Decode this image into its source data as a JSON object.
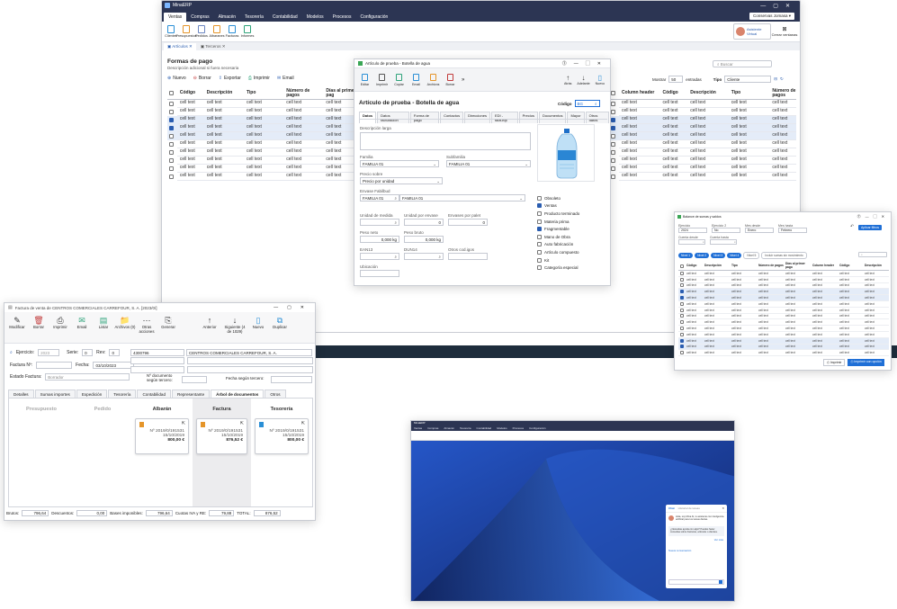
{
  "erp": {
    "title": "MinaERP",
    "menu": [
      "Ventas",
      "Compras",
      "Almacén",
      "Tesorería",
      "Contabilidad",
      "Modelos",
      "Procesos",
      "Configuración"
    ],
    "company": "Conservas Jomasa",
    "ribbon": [
      "Clientes",
      "Presupuestos",
      "Pedidos",
      "Albaranes",
      "Facturas",
      "Informes"
    ],
    "assistant": "Asistente Virtual",
    "close_windows": "Cerrar ventanas",
    "tabs": [
      "Artículos",
      "Terceros"
    ],
    "heading": "Formas de pago",
    "subheading": "Descripción adicional si fuera necesaria",
    "toolbar": [
      "Nuevo",
      "Borrar",
      "Exportar",
      "Imprimir",
      "Email"
    ],
    "columns": [
      "Código",
      "Descripción",
      "Tipo",
      "Número de pagos",
      "Días al primer pag"
    ],
    "right_columns": [
      "Column header",
      "Código",
      "Descripción",
      "Tipo",
      "Número de pagos"
    ],
    "cell": "cell text",
    "show_label": "Mostrar",
    "show_value": "50",
    "entries": "entradas",
    "type_label": "Tipo",
    "type_value": "Cliente",
    "search_placeholder": "Buscar"
  },
  "article": {
    "title": "Artículo de prueba - Botella de agua",
    "tools": [
      "Editar",
      "Imprimir",
      "Copiar",
      "Email",
      "Archivos",
      "Borrar"
    ],
    "nav": [
      "Atrás",
      "Adelante",
      "Nuevo"
    ],
    "heading": "Artículo de prueba - Botella de agua",
    "code_label": "Código",
    "code_value": "BG",
    "tabs": [
      "Datos",
      "Datos facturación",
      "Forma de pago",
      "Contactos",
      "Direcciones",
      "EDI - factur@",
      "Precios",
      "Documentos",
      "Mayor",
      "Otros datos"
    ],
    "long_desc": "Descripción larga",
    "family": "Familia",
    "family_value": "FAMILIA 01",
    "subfamily": "Subfamilia",
    "subfamily_value": "FAMILIA 01",
    "price_on": "Precio sobre",
    "price_on_value": "Precio por unidad",
    "container": "Envase Fabilbud",
    "container_value": "FAMILIA 01",
    "container_value2": "FAMILIA 01",
    "unit": "Unidad de medida",
    "unit_per": "Unidad por envase",
    "per_pallet": "Envases por palet",
    "zero": "0",
    "net_weight": "Peso neto",
    "gross_weight": "Peso bruto",
    "kg": "0,000 kg",
    "ean": "EAN13",
    "dun": "DUN14",
    "other_codes": "Otros cod.igos",
    "location": "Ubicación",
    "checks": [
      {
        "label": "Obsoleto",
        "on": false
      },
      {
        "label": "Ventas",
        "on": true
      },
      {
        "label": "Producto terminado",
        "on": false
      },
      {
        "label": "Materia prima",
        "on": false
      },
      {
        "label": "Fragmentable",
        "on": true
      },
      {
        "label": "Mano de Obra",
        "on": false
      },
      {
        "label": "Auto fabricación",
        "on": false
      },
      {
        "label": "Artículo compuesto",
        "on": false
      },
      {
        "label": "Kit",
        "on": false
      },
      {
        "label": "Categoría especial",
        "on": false
      }
    ]
  },
  "balance": {
    "title": "Balance de sumas y saldos",
    "labels": [
      "Ejercicio",
      "Ejercicio 2",
      "Mes desde",
      "Mes hasta"
    ],
    "values": [
      "2024",
      "No",
      "Enero",
      "Febrero"
    ],
    "acc_from": "Cuenta desde",
    "acc_to": "Cuenta hasta",
    "apply": "Aplicar filtros",
    "levels": [
      "Nivel 1",
      "Nivel 2",
      "Nivel 3",
      "Nivel 4",
      "Nivel 5"
    ],
    "incl": "Incluir sumas sin movimiento",
    "columns": [
      "Código",
      "Descripción",
      "Tipo",
      "Número de pagos",
      "Días al primer pago",
      "Column header",
      "Código",
      "Descripción"
    ],
    "print": "Imprimir",
    "print_excel": "Imprimir con opción"
  },
  "invoice": {
    "title": "Factura de venta de CENTROS COMERCIALES CARREFOUR, S. A. [2023/0/]",
    "tools": [
      "Modificar",
      "Borrar",
      "Imprimir",
      "Email",
      "Listar",
      "Archivos (0)",
      "Otras acciones",
      "Generar",
      "Anterior",
      "Siguiente (4 de 1029)",
      "Nuevo",
      "Duplicar"
    ],
    "ejercicio": "Ejercicio:",
    "ejercicio_v": "2023",
    "serie": "Serie:",
    "serie_v": "0",
    "rev": "Rev:",
    "rev_v": "0",
    "client_code": "4300796",
    "client_name": "CENTROS COMERCIALES CARREFOUR, S. A.",
    "factura_n": "Factura Nº:",
    "fecha": "Fecha:",
    "fecha_v": "03/10/2023",
    "estado": "Estado Factura:",
    "estado_v": "Borrador",
    "doc_tercero": "Nº documento según tercero:",
    "fecha_tercero": "Fecha según tercero:",
    "tabs": [
      "Detalles",
      "Sumas importes",
      "Expedición",
      "Tesorería",
      "Contabilidad",
      "Representante",
      "Árbol de documentos",
      "Otros"
    ],
    "columns": [
      "Presupuesto",
      "Pedido",
      "Albarán",
      "Factura",
      "Tesorería"
    ],
    "cards": [
      {
        "num": "Nº 2019/0/191531",
        "date": "15/10/2019",
        "amount": "800,00 €"
      },
      {
        "num": "Nº 2019/0/191531",
        "date": "15/10/2019",
        "amount": "876,52 €"
      },
      {
        "num": "Nº 2019/0/191531",
        "date": "15/10/2019",
        "amount": "800,00 €"
      }
    ],
    "footer": [
      {
        "l": "Brutos:",
        "v": "796,64"
      },
      {
        "l": "Descuentos:",
        "v": "0,00"
      },
      {
        "l": "Bases imponibles:",
        "v": "796,64"
      },
      {
        "l": "Cuotas IVA y RE:",
        "v": "79,88"
      },
      {
        "l": "TOTAL:",
        "v": "876,52"
      }
    ]
  },
  "desktop": {
    "chat_tabs": [
      "Chat",
      "Historial de tareas"
    ],
    "greeting": "Hola, soy Mina AI, tu asistente con inteligencia artificial para tus tareas diarias.",
    "answer": "¿Necesitas ayuda con algo? Puedes hacer consultas sobre Facturas, artículos o clientes.",
    "link": "Ver más",
    "new_chat": "Nueva conversación"
  },
  "colors": {
    "navy": "#2c3553",
    "blue": "#2a5db0",
    "accent": "#1f6fd6"
  }
}
